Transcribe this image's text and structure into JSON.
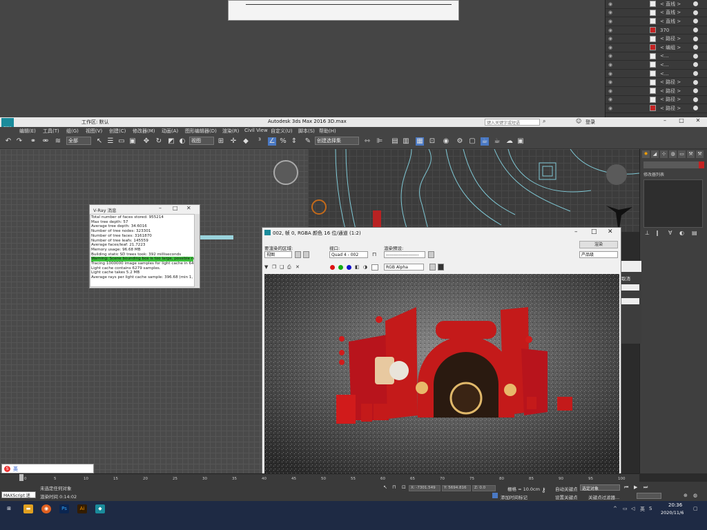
{
  "layers_panel": {
    "rows": [
      {
        "label": "< 直线 >",
        "thumb": "white"
      },
      {
        "label": "< 直线 >",
        "thumb": "white"
      },
      {
        "label": "< 直线 >",
        "thumb": "white"
      },
      {
        "label": "370",
        "thumb": "red"
      },
      {
        "label": "< 路径 >",
        "thumb": "white"
      },
      {
        "label": "< 编组 >",
        "thumb": "red"
      },
      {
        "label": "<...",
        "thumb": "white"
      },
      {
        "label": "<...",
        "thumb": "white"
      },
      {
        "label": "<...",
        "thumb": "white"
      },
      {
        "label": "< 路径 >",
        "thumb": "white"
      },
      {
        "label": "< 路径 >",
        "thumb": "white"
      },
      {
        "label": "< 路径 >",
        "thumb": "white"
      },
      {
        "label": "< 路径 >",
        "thumb": "red"
      }
    ]
  },
  "titlebar": {
    "title": "Autodesk 3ds Max 2016     3D.max",
    "logo_label": "MAX",
    "workspace": "工作区: 默认",
    "search_placeholder": "键入关键字或短语",
    "login": "登录",
    "minimize": "–",
    "maximize": "□",
    "close": "✕"
  },
  "menu": [
    "编辑(E)",
    "工具(T)",
    "组(G)",
    "视图(V)",
    "创建(C)",
    "修改器(M)",
    "动画(A)",
    "图形编辑器(D)",
    "渲染(R)",
    "Civil View",
    "自定义(U)",
    "脚本(S)",
    "帮助(H)"
  ],
  "toolbar": {
    "selection_filter": "全部",
    "ref_coord": "视图",
    "named_selection": "创建选择集"
  },
  "command_panel": {
    "modifier_list_label": "修改器列表"
  },
  "vray_log": {
    "title": "V-Ray 消息",
    "lines": [
      "Total number of faces stored: 955214",
      "Max tree depth: 57",
      "Average tree depth: 34.6016",
      "Number of tree nodes: 323301",
      "Number of tree faces: 3161870",
      "Number of tree leafs: 145559",
      "Average faces/leaf: 21.7223",
      "Memory usage: 96.68 MB",
      "Building static SD trees took: 392 milliseconds"
    ],
    "warning": "Warning: Scene bounding box is too large, possible raycast e",
    "tail": [
      "Tracing 1000000 image samples for light cache in 64 passes",
      "Light cache contains 6279 samples.",
      "Light cache takes 5.2 MB",
      "Average rays per light cache sample: 396.68 (min 1, max 43"
    ]
  },
  "render_frame": {
    "title": "002, 帧 0, RGBA 颜色 16 位/通道 (1:2)",
    "area_label": "要渲染的区域:",
    "area_value": "视图",
    "viewport_label": "视口:",
    "viewport_value": "Quad 4 - 002",
    "preset_label": "渲染预设:",
    "preset_value": "----------------------",
    "render_button": "渲染",
    "product_level": "产品级",
    "channel": "RGB Alpha"
  },
  "side_dialog": {
    "cancel": "取消"
  },
  "timeline": {
    "ticks": [
      "0",
      "5",
      "10",
      "15",
      "20",
      "25",
      "30",
      "35",
      "40",
      "45",
      "50",
      "55",
      "60",
      "65",
      "70",
      "75",
      "80",
      "85",
      "90",
      "95",
      "100"
    ]
  },
  "status": {
    "maxscript": "MAXScript 迷",
    "selection": "未选定任何对象",
    "render_time": "渲染时间 0:14:02",
    "x": "X: -7301.549",
    "y": "Y: 5694.816",
    "z": "Z: 0.0",
    "grid": "栅格 = 10.0cm",
    "add_time_tag": "添加时间标记",
    "auto_key": "自动关键点",
    "set_key": "设置关键点",
    "selected_obj": "选定对象",
    "key_filters": "关键点过滤器..."
  },
  "ime": {
    "label": "英"
  },
  "taskbar": {
    "time": "20:36",
    "date": "2020/11/6",
    "lang": "英"
  },
  "colors": {
    "accent": "#1a8b9b",
    "taskbar": "#1e2a44",
    "warning": "#3cbf3c",
    "stage_red": "#c41a1a"
  }
}
